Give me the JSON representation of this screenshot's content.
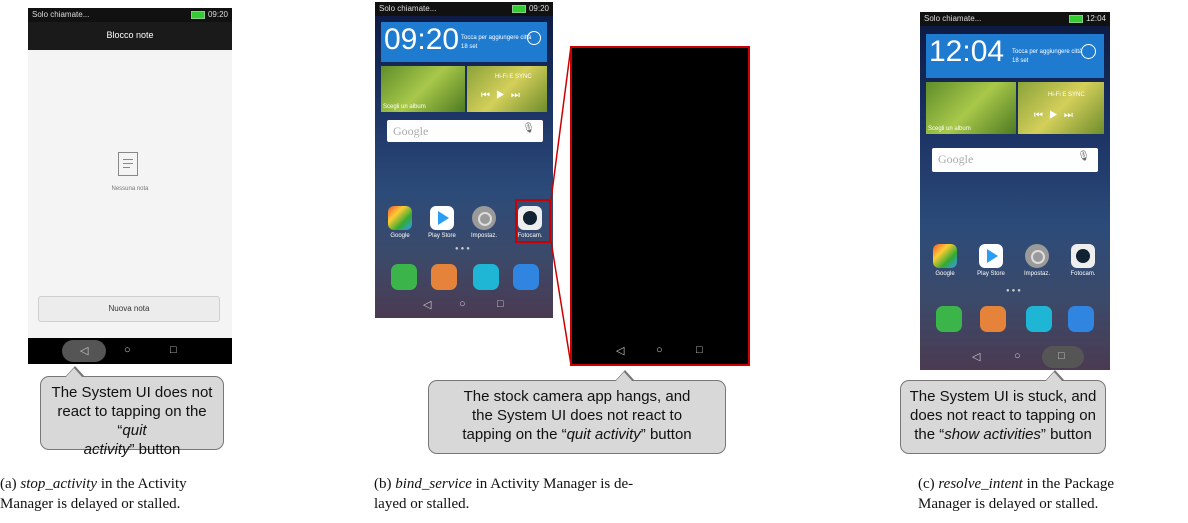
{
  "panel_a": {
    "status_left": "Solo chiamate...",
    "status_time": "09:20",
    "title": "Blocco note",
    "empty_text": "Nessuna nota",
    "button": "Nuova nota",
    "callout_line1": "The System UI does not",
    "callout_line2": "react to tapping on the “",
    "callout_em": "quit",
    "callout_line3_em": "activity",
    "callout_line3": "” button",
    "caption_label": "(a) ",
    "caption_em": "stop_activity",
    "caption_rest1": " in the Activity",
    "caption_rest2": "Manager is delayed or stalled."
  },
  "panel_b": {
    "status_left": "Solo chiamate...",
    "status_time": "09:20",
    "clock": "09:20",
    "clock_sub1": "Tocca per aggiungere città",
    "clock_sub2": "18 set",
    "album": "Scegli un album",
    "music": "Hi-Fi E SYNC",
    "search": "Google",
    "apps": [
      "Google",
      "Play Store",
      "Impostaz.",
      "Fotocam."
    ],
    "callout_line1": "The stock camera app hangs, and",
    "callout_line2": "the System UI does not react to",
    "callout_line3a": "tapping on the “",
    "callout_em": "quit activity",
    "callout_line3b": "” button",
    "caption_label": "(b) ",
    "caption_em": "bind_service",
    "caption_rest1": " in Activity Manager is de-",
    "caption_rest2": "layed or stalled."
  },
  "panel_c": {
    "status_left": "Solo chiamate...",
    "status_time": "12:04",
    "clock": "12:04",
    "clock_sub1": "Tocca per aggiungere città",
    "clock_sub2": "18 set",
    "album": "Scegli un album",
    "music": "Hi-Fi E SYNC",
    "search": "Google",
    "apps": [
      "Google",
      "Play Store",
      "Impostaz.",
      "Fotocam."
    ],
    "callout_line1": "The System UI is stuck, and",
    "callout_line2": "does not react to tapping on",
    "callout_line3a": "the “",
    "callout_em": "show activities",
    "callout_line3b": "” button",
    "caption_label": "(c) ",
    "caption_em": "resolve_intent",
    "caption_rest1": " in the Package",
    "caption_rest2": "Manager is delayed or stalled."
  },
  "colors": {
    "highlight": "#cc0000",
    "clock_tile": "#1e7bd0",
    "callout_bg": "#d8d8d8"
  },
  "icons": [
    "note-icon",
    "back-icon",
    "home-icon",
    "recent-icon",
    "mic-icon",
    "sun-icon"
  ]
}
